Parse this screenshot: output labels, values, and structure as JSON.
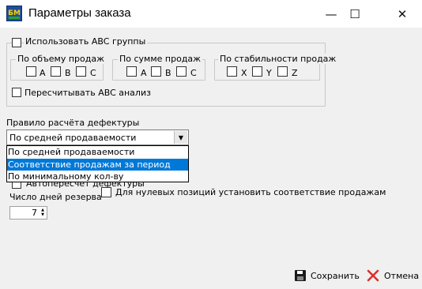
{
  "window": {
    "icon_text": "БМ",
    "title": "Параметры заказа",
    "minimize_glyph": "—",
    "maximize_glyph": "☐",
    "close_glyph": "✕"
  },
  "abc": {
    "use_groups_label": "Использовать ABC группы",
    "use_groups_checked": false,
    "by_volume": {
      "title": "По объему продаж",
      "options": [
        "A",
        "B",
        "C"
      ]
    },
    "by_sum": {
      "title": "По сумме продаж",
      "options": [
        "A",
        "B",
        "C"
      ]
    },
    "by_stability": {
      "title": "По стабильности продаж",
      "options": [
        "X",
        "Y",
        "Z"
      ]
    },
    "recalc_label": "Пересчитывать ABC анализ",
    "recalc_checked": false
  },
  "defect_rule": {
    "label": "Правило расчёта дефектуры",
    "selected": "По средней продаваемости",
    "options": [
      "По средней продаваемости",
      "Соответствие продажам за период",
      "По минимальному кол-ву"
    ],
    "highlighted_index": 1
  },
  "auto_defect_label": "Автопересчет дефектуры",
  "zero_positions_label": "Для нулевых позиций установить соответствие продажам",
  "reserve_days": {
    "label": "Число дней резерва",
    "value": "7"
  },
  "buttons": {
    "save": "Сохранить",
    "cancel": "Отмена"
  },
  "colors": {
    "highlight": "#0078d7",
    "window_bg": "#f0f0f0",
    "cancel_icon": "#d9312b"
  }
}
